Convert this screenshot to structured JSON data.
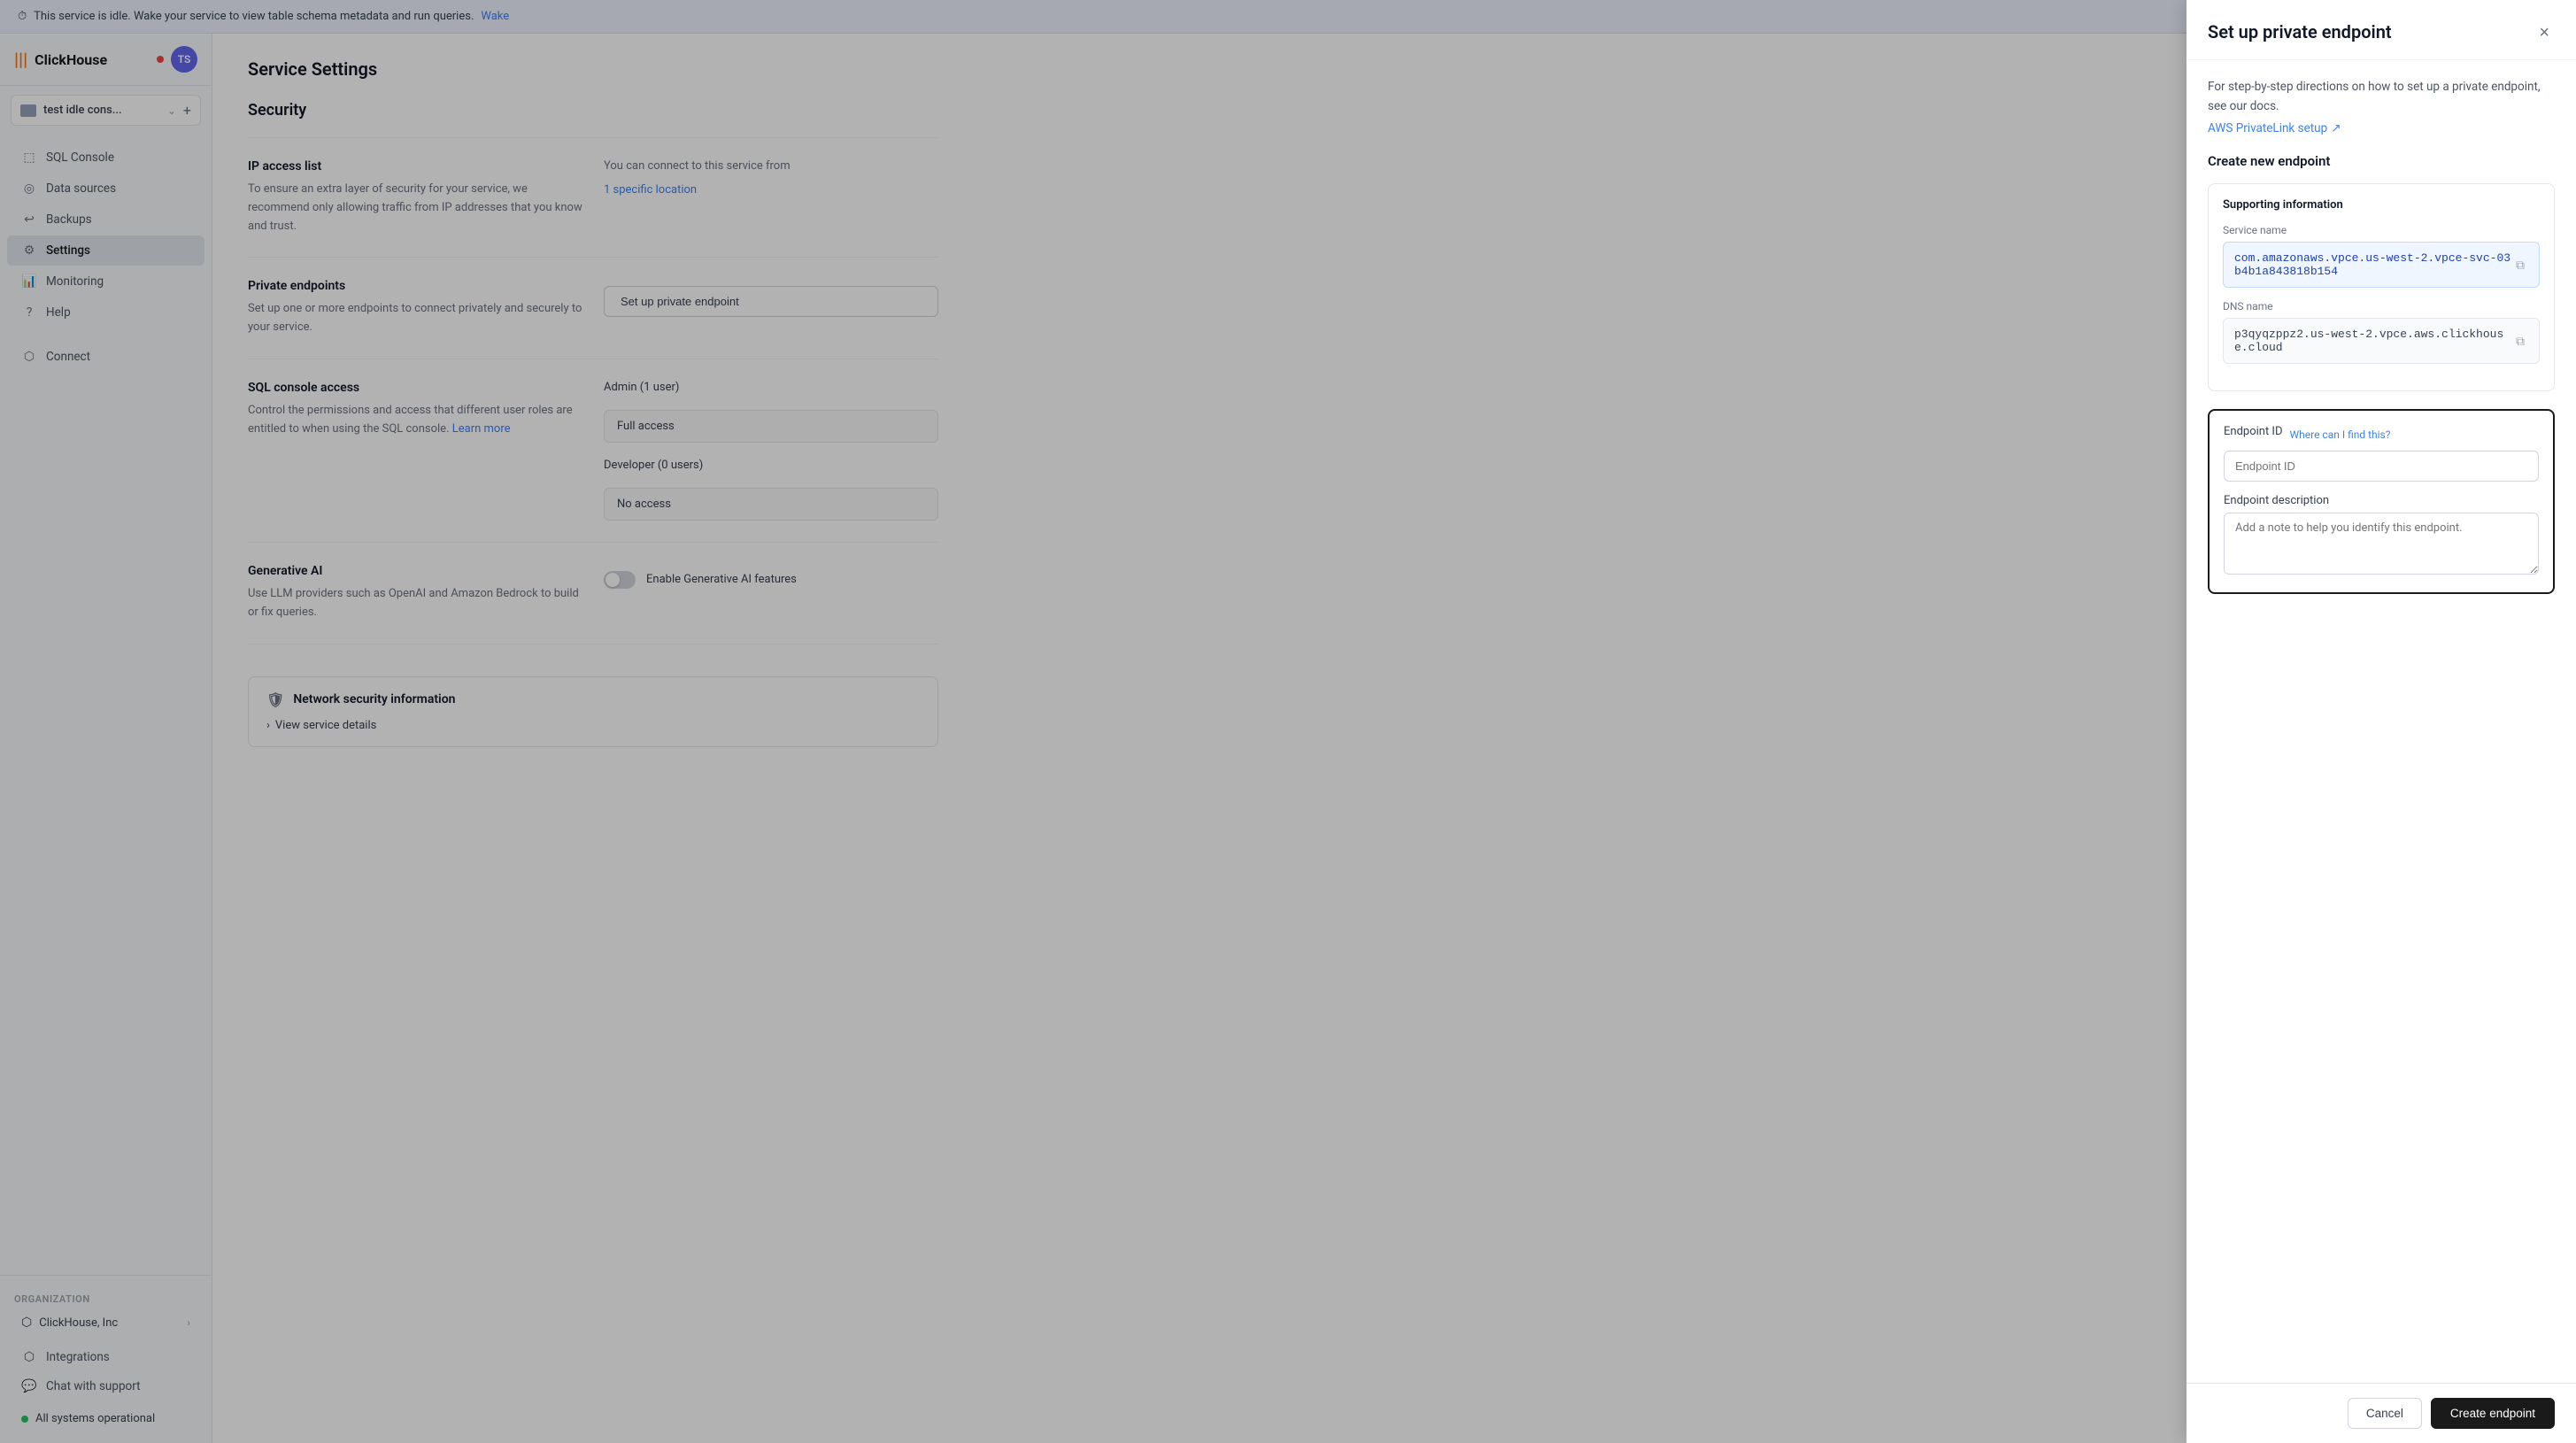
{
  "banner": {
    "text": "This service is idle. Wake your service to view table schema metadata and run queries.",
    "link_text": "Wake",
    "icon": "⏱"
  },
  "sidebar": {
    "logo": "ClickHouse",
    "logo_icon": "|||",
    "status_dot_color": "#ef4444",
    "avatar_initials": "TS",
    "service_name": "test idle cons...",
    "nav_items": [
      {
        "id": "sql-console",
        "label": "SQL Console",
        "icon": "⬚"
      },
      {
        "id": "data-sources",
        "label": "Data sources",
        "icon": "◎"
      },
      {
        "id": "backups",
        "label": "Backups",
        "icon": "↩"
      },
      {
        "id": "settings",
        "label": "Settings",
        "icon": "⚙",
        "active": true
      },
      {
        "id": "monitoring",
        "label": "Monitoring",
        "icon": "📊"
      },
      {
        "id": "help",
        "label": "Help",
        "icon": "?"
      }
    ],
    "org_label": "Organization",
    "org_name": "ClickHouse, Inc",
    "footer_items": [
      {
        "id": "integrations",
        "label": "Integrations",
        "icon": "⬡"
      },
      {
        "id": "chat-support",
        "label": "Chat with support",
        "icon": "💬"
      }
    ],
    "system_status": "All systems operational",
    "connect_label": "Connect"
  },
  "main": {
    "page_title": "Service Settings",
    "section_title": "Security",
    "ip_access": {
      "label": "IP access list",
      "desc": "To ensure an extra layer of security for your service, we recommend only allowing traffic from IP addresses that you know and trust.",
      "connect_from": "You can connect to this service from",
      "location_text": "1 specific location"
    },
    "private_endpoints": {
      "label": "Private endpoints",
      "desc": "Set up one or more endpoints to connect privately and securely to your service.",
      "button": "Set up private endpoint"
    },
    "sql_console": {
      "label": "SQL console access",
      "desc": "Control the permissions and access that different user roles are entitled to when using the SQL console.",
      "learn_more": "Learn more",
      "admin_label": "Admin (1 user)",
      "admin_access": "Full access",
      "dev_label": "Developer (0 users)",
      "dev_access": "No access"
    },
    "gen_ai": {
      "label": "Generative AI",
      "desc": "Use LLM providers such as OpenAI and Amazon Bedrock to build or fix queries.",
      "toggle_label": "Enable Generative AI features"
    },
    "network": {
      "label": "Network security information",
      "view_details": "View service details"
    }
  },
  "panel": {
    "title": "Set up private endpoint",
    "close_icon": "×",
    "desc": "For step-by-step directions on how to set up a private endpoint, see our docs.",
    "docs_link": "AWS PrivateLink setup",
    "docs_icon": "↗",
    "create_section": "Create new endpoint",
    "supporting_info_title": "Supporting information",
    "service_name_label": "Service name",
    "service_name_value": "com.amazonaws.vpce.us-west-2.vpce-svc-03b4b1a843818b154",
    "dns_name_label": "DNS name",
    "dns_name_value": "p3qyqzppz2.us-west-2.vpce.aws.clickhouse.cloud",
    "endpoint_id_label": "Endpoint ID",
    "where_link": "Where can I find this?",
    "endpoint_id_placeholder": "Endpoint ID",
    "endpoint_desc_label": "Endpoint description",
    "endpoint_desc_placeholder": "Add a note to help you identify this endpoint.",
    "cancel_btn": "Cancel",
    "create_btn": "Create endpoint"
  }
}
